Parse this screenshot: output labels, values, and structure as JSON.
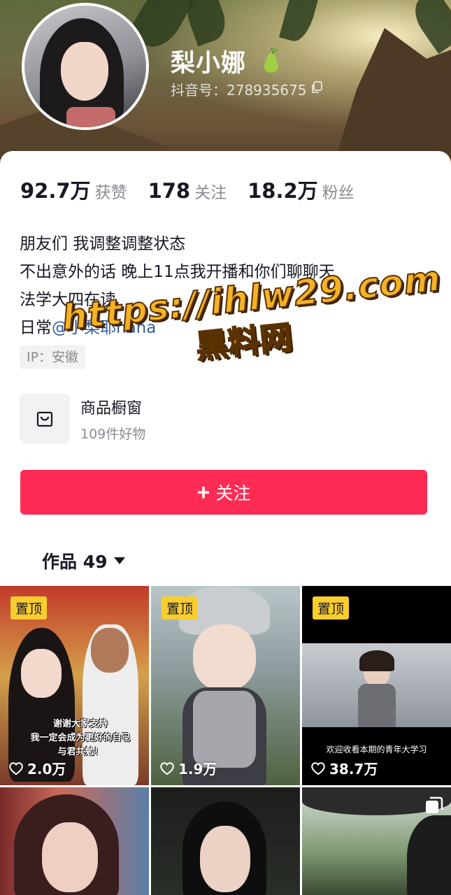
{
  "profile": {
    "name": "梨小娜",
    "douyin_id": "抖音号：278935675"
  },
  "stats": [
    {
      "num": "92.7万",
      "label": "获赞"
    },
    {
      "num": "178",
      "label": "关注"
    },
    {
      "num": "18.2万",
      "label": "粉丝"
    }
  ],
  "bio": {
    "line1": "朋友们 我调整调整状态",
    "line2": "不出意外的话 晚上11点我开播和你们聊聊天",
    "line3": "法学大四在读",
    "line4_prefix": "日常",
    "line4_mention": "@小梨耶nana"
  },
  "ip": "IP：安徽",
  "watermark": {
    "url": "https://ihlw29.com",
    "cn": "黑料网"
  },
  "shop": {
    "title": "商品橱窗",
    "subtitle": "109件好物"
  },
  "follow_button": {
    "label": "关注"
  },
  "works_tab": {
    "label": "作品 49"
  },
  "videos": [
    {
      "pinned": "置顶",
      "likes": "2.0万",
      "caption_line1": "谢谢大家支持",
      "caption_line2": "我一定会成为更好的自己",
      "caption_line3": "与君共勉！"
    },
    {
      "pinned": "置顶",
      "likes": "1.9万"
    },
    {
      "pinned": "置顶",
      "likes": "38.7万",
      "caption": "欢迎收看本期的青年大学习"
    },
    {},
    {},
    {}
  ],
  "colors": {
    "accent": "#fe2c55",
    "pin_badge": "#facd2f",
    "mention": "#2f5c9a"
  }
}
